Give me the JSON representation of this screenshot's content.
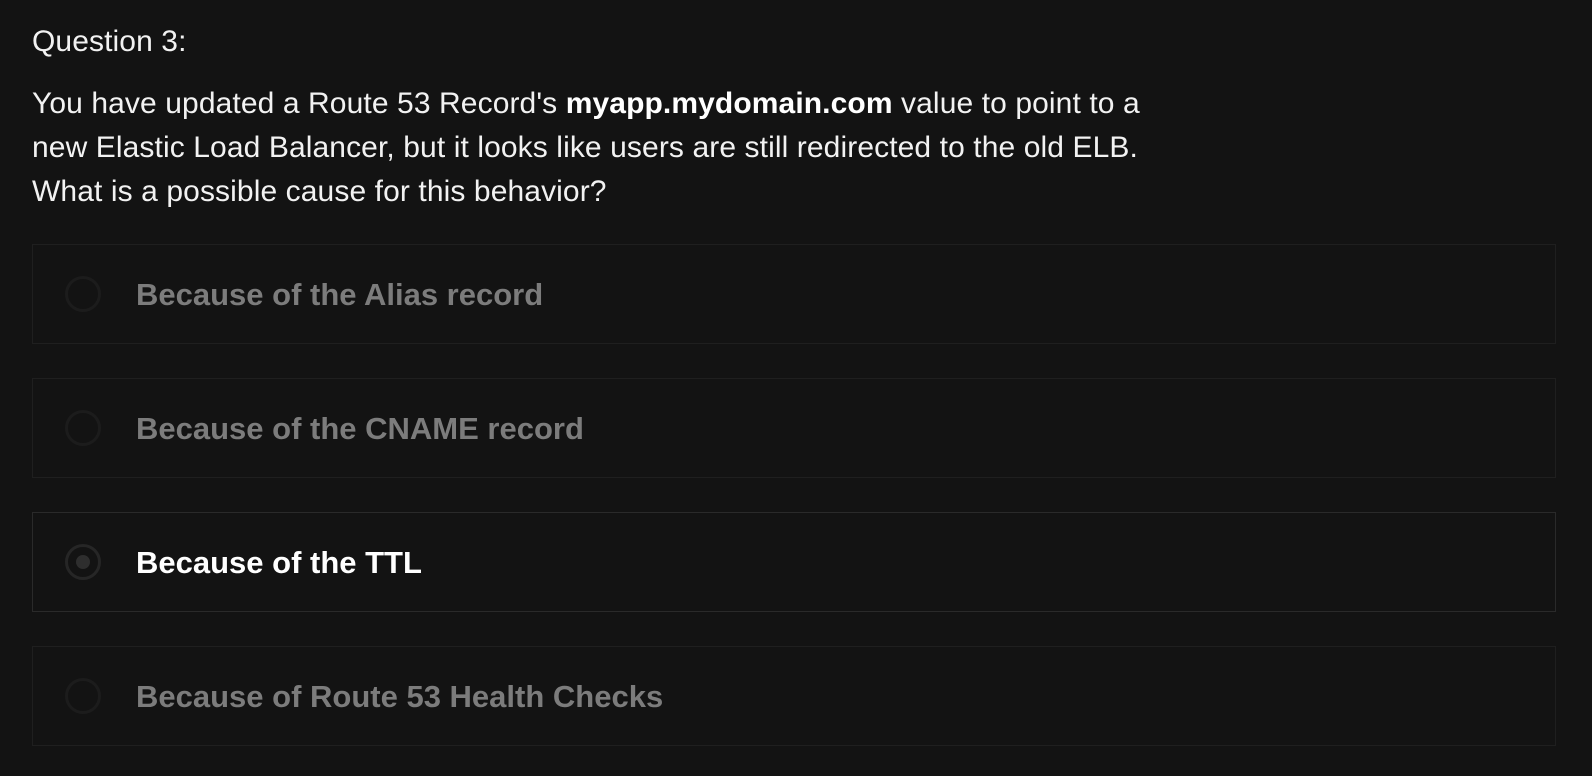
{
  "question": {
    "title": "Question 3:",
    "text_before": "You have updated a Route 53 Record's ",
    "text_bold": "myapp.mydomain.com",
    "text_after_line1": " value to point to a",
    "text_line2": "new Elastic Load Balancer, but it looks like users are still redirected to the old ELB.",
    "text_line3": "What is a possible cause for this behavior?"
  },
  "answers": [
    {
      "label": "Because of the Alias record",
      "selected": false
    },
    {
      "label": "Because of the CNAME record",
      "selected": false
    },
    {
      "label": "Because of the TTL",
      "selected": true
    },
    {
      "label": "Because of Route 53 Health Checks",
      "selected": false
    }
  ],
  "colors": {
    "background": "#131313",
    "text_primary": "#ffffff",
    "text_muted": "#7c7c7c",
    "border": "#1f1f1f"
  }
}
